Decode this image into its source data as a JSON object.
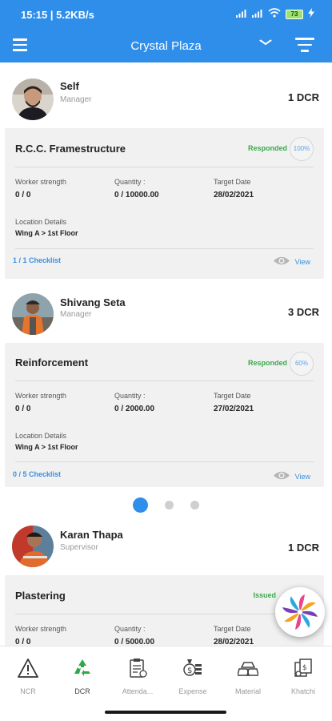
{
  "status_bar": {
    "time": "15:15 | 5.2KB/s",
    "battery": "73"
  },
  "app_bar": {
    "title": "Crystal Plaza"
  },
  "persons": [
    {
      "name": "Self",
      "role": "Manager",
      "dcr": "1 DCR"
    },
    {
      "name": "Shivang Seta",
      "role": "Manager",
      "dcr": "3 DCR"
    },
    {
      "name": "Karan Thapa",
      "role": "Supervisor",
      "dcr": "1 DCR"
    }
  ],
  "cards": [
    {
      "task": "R.C.C. Framestructure",
      "status": "Responded",
      "percent": "100%",
      "worker_strength_label": "Worker strength",
      "worker_strength": "0  /  0",
      "quantity_label": "Quantity :",
      "quantity": "0  /  10000.00",
      "target_date_label": "Target Date",
      "target_date": "28/02/2021",
      "location_label": "Location Details",
      "location": "Wing A > 1st Floor",
      "checklist": "1 / 1 Checklist",
      "view": "View"
    },
    {
      "task": "Reinforcement",
      "status": "Responded",
      "percent": "60%",
      "worker_strength_label": "Worker strength",
      "worker_strength": "0  /  0",
      "quantity_label": "Quantity :",
      "quantity": "0  /  2000.00",
      "target_date_label": "Target Date",
      "target_date": "27/02/2021",
      "location_label": "Location Details",
      "location": "Wing A > 1st Floor",
      "checklist": "0 / 5 Checklist",
      "view": "View"
    },
    {
      "task": "Plastering",
      "status": "Issued",
      "worker_strength_label": "Worker strength",
      "worker_strength": "0  /  0",
      "quantity_label": "Quantity :",
      "quantity": "0  /  5000.00",
      "target_date_label": "Target Date",
      "target_date": "28/02/2021"
    }
  ],
  "pager": {
    "pages": 3,
    "active": 1
  },
  "bottom_nav": [
    {
      "label": "NCR",
      "icon": "warning-icon"
    },
    {
      "label": "DCR",
      "icon": "recycle-icon",
      "active": true
    },
    {
      "label": "Attenda...",
      "icon": "attendance-icon"
    },
    {
      "label": "Expense",
      "icon": "expense-icon"
    },
    {
      "label": "Material",
      "icon": "material-icon"
    },
    {
      "label": "Khatchi",
      "icon": "khatchi-icon"
    }
  ],
  "colors": {
    "primary": "#2f8eea",
    "responded": "#3ba84a",
    "link": "#3b8ee0",
    "card_bg": "#f1f1f1"
  }
}
